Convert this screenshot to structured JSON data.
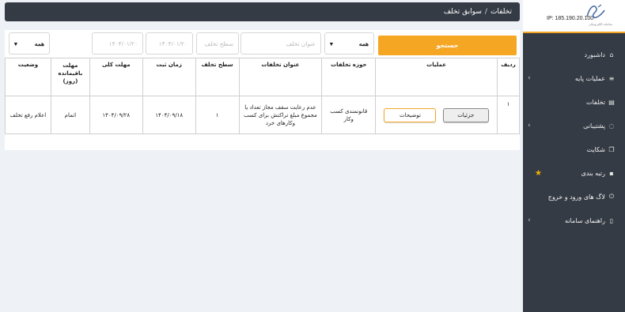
{
  "header": {
    "breadcrumb_parent": "تخلفات",
    "separator": "/",
    "breadcrumb_current": "سوابق تخلف"
  },
  "brand": {
    "ip": "IP: 185.190.20.100",
    "logo_sub": "سامانه الکترونیکی"
  },
  "sidebar": {
    "items": [
      {
        "label": "داشبورد",
        "icon": "home-icon"
      },
      {
        "label": "عملیات پایه",
        "icon": "menu-icon",
        "has_chevron": true
      },
      {
        "label": "تخلفات",
        "icon": "book-icon"
      },
      {
        "label": "پشتیبانی",
        "icon": "chat-icon",
        "has_chevron": true
      },
      {
        "label": "شکایت",
        "icon": "copy-icon"
      },
      {
        "label": "رتبه بندی",
        "icon": "rank-icon",
        "has_star": true
      },
      {
        "label": "لاگ های ورود و خروج",
        "icon": "power-icon"
      },
      {
        "label": "راهنمای سامانه",
        "icon": "file-icon",
        "has_chevron": true
      }
    ]
  },
  "filters": {
    "status_select": "همه",
    "deadline_to": "۱۴۰۴/۰۱/۲۰",
    "register_date": "۱۴۰۴/۰۱/۲۰",
    "level_placeholder": "سطح تخلف",
    "title_placeholder": "عنوان تخلف",
    "area_select": "همه",
    "search_label": "جستجو"
  },
  "table": {
    "headers": {
      "row": "ردیف",
      "actions": "عملیات",
      "area": "حوزه تخلفات",
      "title": "عنوان تخلفات",
      "level": "سطح تخلف",
      "time": "زمان ثبت",
      "deadline": "مهلت کلی",
      "remaining": "مهلت باقیمانده (روز)",
      "status": "وضعیت"
    },
    "rows": [
      {
        "row": "۱",
        "detail_label": "جزئیات",
        "desc_label": "توضیحات",
        "area": "قانونمندی کسب وکار",
        "title": "عدم رعایت سقف مجاز تعداد یا مجموع مبلغ تراکنش برای کسب وکارهای خرد",
        "level": "۱",
        "time": "۱۴۰۴/۰۹/۱۸",
        "deadline": "۱۴۰۴/۰۹/۲۸",
        "remaining": "اتمام",
        "status": "اعلام رفع تخلف"
      }
    ]
  },
  "colors": {
    "accent": "#f5a623",
    "sidebar_bg": "#353b44",
    "page_bg": "#eef1f6"
  }
}
